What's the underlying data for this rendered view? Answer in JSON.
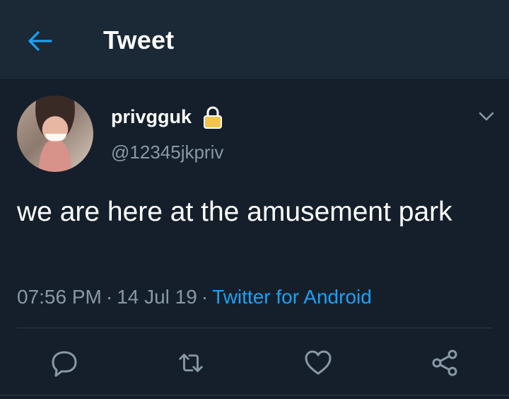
{
  "header": {
    "title": "Tweet"
  },
  "tweet": {
    "display_name": "privgguk",
    "handle": "@12345jkpriv",
    "text": "we are here at the amusement park",
    "time": "07:56 PM",
    "separator": "·",
    "date": "14 Jul 19",
    "source": "Twitter for Android"
  },
  "icons": {
    "back": "arrow-left-icon",
    "lock": "lock-icon",
    "menu": "chevron-down-icon",
    "reply": "reply-icon",
    "retweet": "retweet-icon",
    "like": "heart-icon",
    "share": "share-icon"
  },
  "colors": {
    "background": "#151f2b",
    "header_background": "#1b2836",
    "accent": "#1da1f2",
    "secondary_text": "#8899a6"
  }
}
